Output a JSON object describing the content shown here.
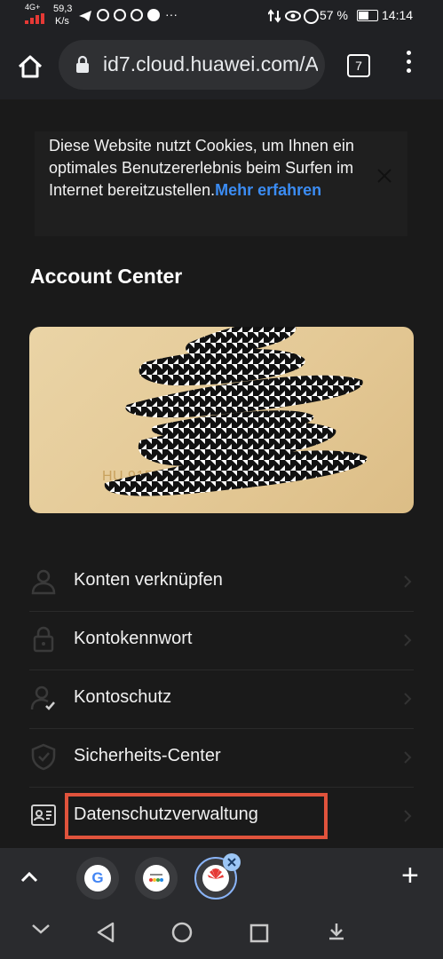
{
  "status_bar": {
    "network": "4G+",
    "speed_value": "59,3",
    "speed_unit": "K/s",
    "battery": "57 %",
    "time": "14:14",
    "more": "···"
  },
  "browser": {
    "url": "id7.cloud.huawei.com/A",
    "tab_count": "7"
  },
  "cookie_banner": {
    "text": "Diese Website nutzt Cookies, um Ihnen ein optimales Benutzererlebnis beim Surfen im Internet bereitzustellen.",
    "link": "Mehr erfahren"
  },
  "page": {
    "title": "Account Center"
  },
  "account_card": {
    "partial_id": "HU                 91520628"
  },
  "menu": {
    "items": [
      {
        "label": "Konten verknüpfen",
        "icon": "person-icon"
      },
      {
        "label": "Kontokennwort",
        "icon": "lock-icon"
      },
      {
        "label": "Kontoschutz",
        "icon": "person-check-icon"
      },
      {
        "label": "Sicherheits-Center",
        "icon": "shield-check-icon"
      },
      {
        "label": "Datenschutzverwaltung",
        "icon": "id-card-icon"
      }
    ]
  },
  "bottom_toolbar": {
    "plus": "+",
    "google_letter": "G"
  },
  "colors": {
    "link": "#3b8cf3",
    "highlight": "#e0533c",
    "card": "#e6cc9a"
  }
}
